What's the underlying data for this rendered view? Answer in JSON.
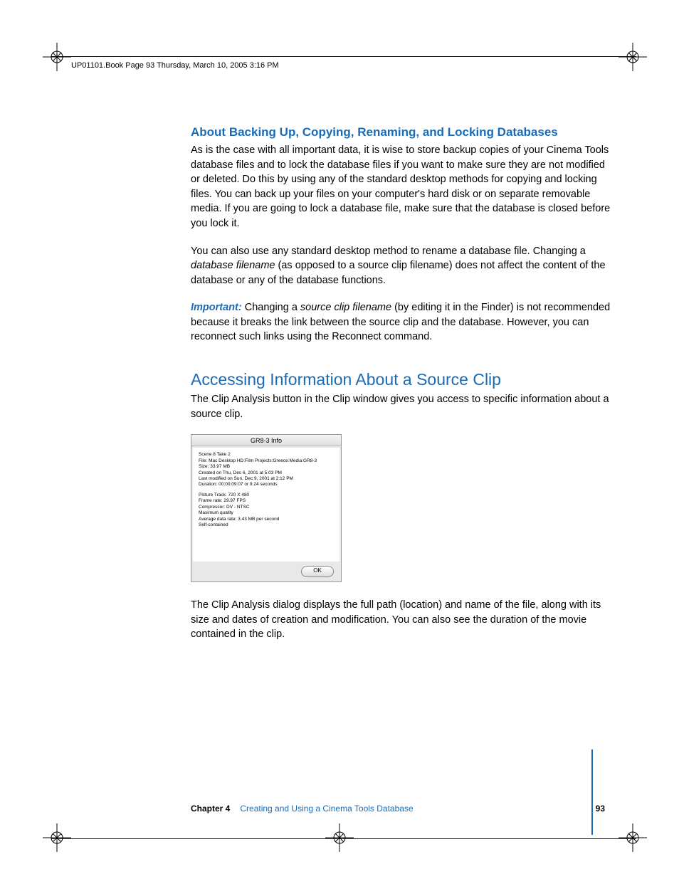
{
  "header": {
    "crop_text": "UP01101.Book  Page 93  Thursday, March 10, 2005  3:16 PM"
  },
  "section1": {
    "heading": "About Backing Up, Copying, Renaming, and Locking Databases",
    "p1": "As is the case with all important data, it is wise to store backup copies of your Cinema Tools database files and to lock the database files if you want to make sure they are not modified or deleted. Do this by using any of the standard desktop methods for copying and locking files. You can back up your files on your computer's hard disk or on separate removable media. If you are going to lock a database file, make sure that the database is closed before you lock it.",
    "p2a": "You can also use any standard desktop method to rename a database file. Changing a ",
    "p2_italic": "database filename",
    "p2b": " (as opposed to a source clip filename) does not affect the content of the database or any of the database functions.",
    "imp_label": "Important:  ",
    "imp_a": "Changing a ",
    "imp_italic": "source clip filename",
    "imp_b": " (by editing it in the Finder) is not recommended because it breaks the link between the source clip and the database. However, you can reconnect such links using the Reconnect command."
  },
  "section2": {
    "title": "Accessing Information About a Source Clip",
    "intro": "The Clip Analysis button in the Clip window gives you access to specific information about a source clip.",
    "dialog": {
      "title": "GR8-3 Info",
      "l1": "Scene 8 Take 2",
      "l2": "File: Mac Desktop HD:Film Projects:Greece:Media:GR8-3",
      "l3": "Size: 33.97 MB",
      "l4": "Created on Thu, Dec 6, 2001 at 5:03 PM",
      "l5": "Last modified on Sun, Dec 9, 2001 at 2:12 PM",
      "l6": "Duration: 00:00:09:07 or 9.24 seconds",
      "l7": "Picture Track: 720 X 480",
      "l8": "Frame rate: 29.97 FPS",
      "l9": "Compressor: DV - NTSC",
      "l10": "Maximum quality",
      "l11": "Average data rate: 3.43 MB per second",
      "l12": "Self-contained",
      "ok": "OK"
    },
    "after": "The Clip Analysis dialog displays the full path (location) and name of the file, along with its size and dates of creation and modification. You can also see the duration of the movie contained in the clip."
  },
  "footer": {
    "chapter_num": "Chapter 4",
    "chapter_title": "Creating and Using a Cinema Tools Database",
    "page": "93"
  }
}
